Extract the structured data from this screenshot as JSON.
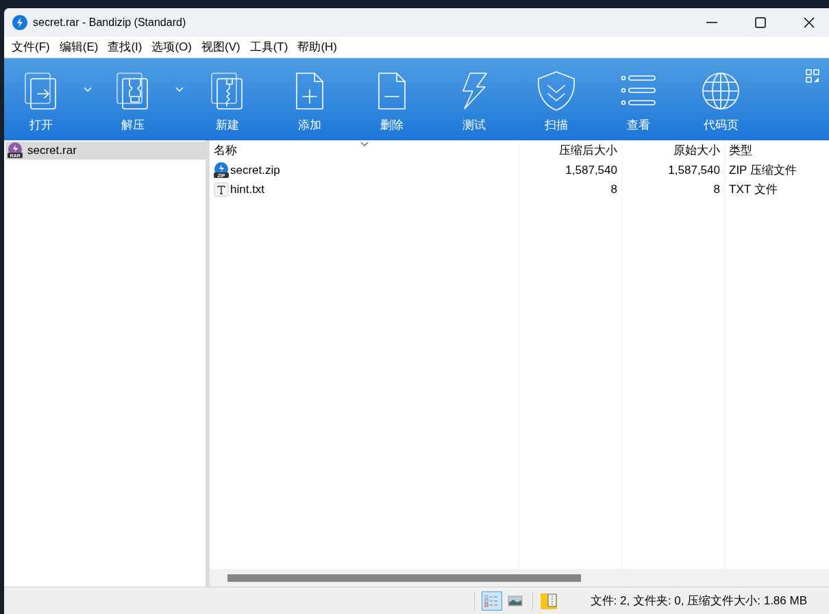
{
  "window": {
    "title": "secret.rar - Bandizip (Standard)"
  },
  "menu": [
    "文件(F)",
    "编辑(E)",
    "查找(I)",
    "选项(O)",
    "视图(V)",
    "工具(T)",
    "帮助(H)"
  ],
  "toolbar": [
    {
      "label": "打开",
      "kind": "split"
    },
    {
      "label": "解压",
      "kind": "split"
    },
    {
      "label": "新建",
      "kind": "plain"
    },
    {
      "label": "添加",
      "kind": "plain"
    },
    {
      "label": "删除",
      "kind": "plain"
    },
    {
      "label": "测试",
      "kind": "plain"
    },
    {
      "label": "扫描",
      "kind": "plain"
    },
    {
      "label": "查看",
      "kind": "plain"
    },
    {
      "label": "代码页",
      "kind": "plain"
    }
  ],
  "tree": [
    {
      "label": "secret.rar",
      "badge": "RAR",
      "selected": true
    }
  ],
  "table": {
    "columns": [
      "名称",
      "压缩后大小",
      "原始大小",
      "类型"
    ],
    "rows": [
      {
        "kind": "zip",
        "badge": "ZIP",
        "cells": [
          "secret.zip",
          "1,587,540",
          "1,587,540",
          "ZIP 压缩文件"
        ],
        "selected": false
      },
      {
        "kind": "txt",
        "cells": [
          "hint.txt",
          "8",
          "8",
          "TXT 文件"
        ],
        "selected": false
      }
    ]
  },
  "status_bar": {
    "view_buttons": [
      {
        "selected": true
      },
      {
        "selected": false
      }
    ],
    "text": "文件: 2, 文件夹: 0, 压缩文件大小: 1.86 MB"
  }
}
